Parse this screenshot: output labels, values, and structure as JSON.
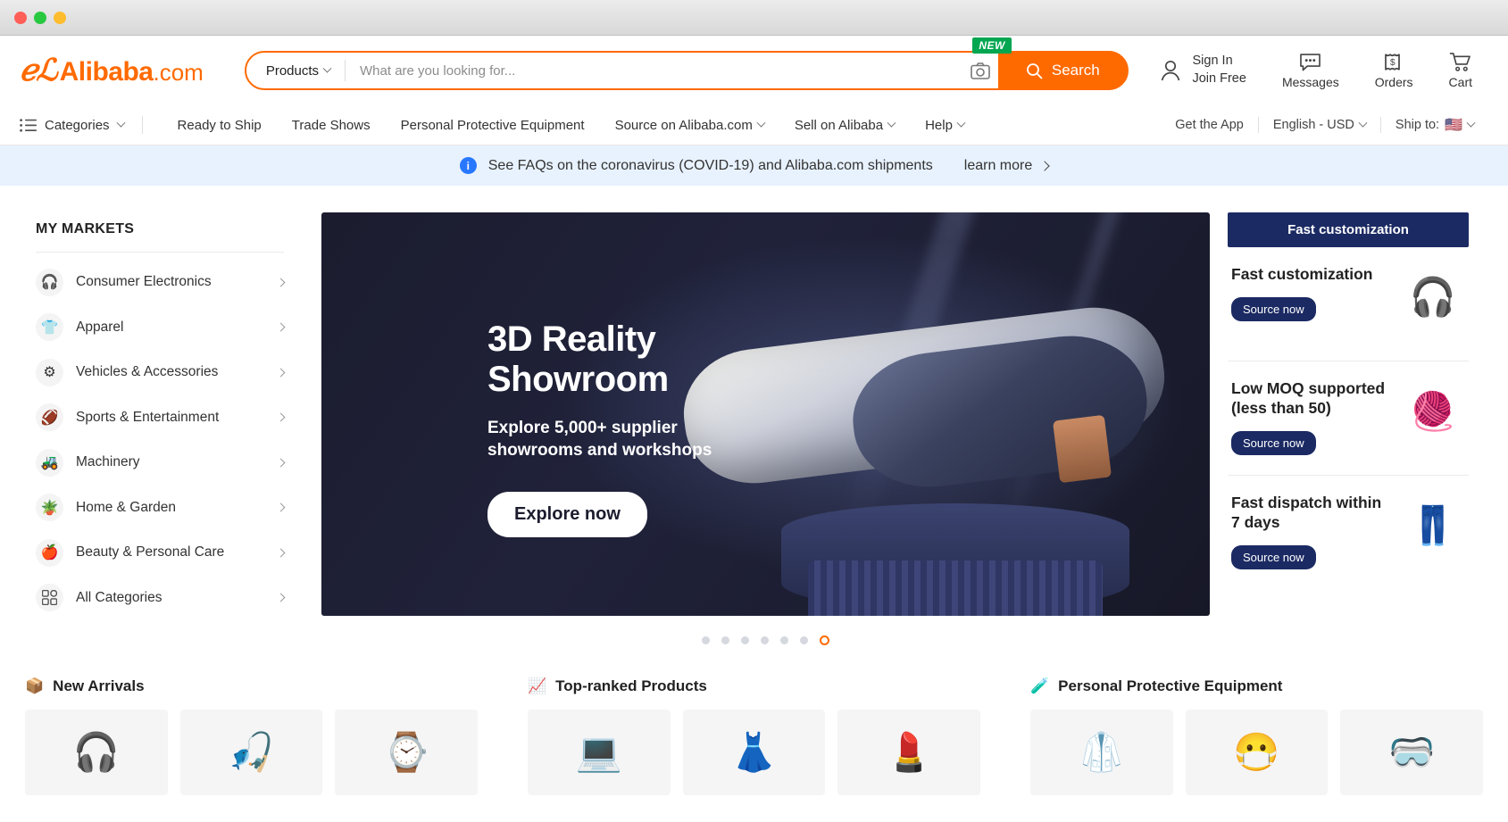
{
  "window": {
    "controls": [
      "close",
      "minimize",
      "maximize"
    ]
  },
  "header": {
    "logo": {
      "mark": "ℛ",
      "name": "Alibaba",
      "tld": ".com"
    },
    "search": {
      "category_label": "Products",
      "placeholder": "What are you looking for...",
      "value": "",
      "button_label": "Search",
      "camera_icon": "camera-icon",
      "new_badge": "NEW"
    },
    "account": {
      "line1": "Sign In",
      "line2": "Join Free",
      "icon": "user-icon"
    },
    "items": [
      {
        "label": "Messages",
        "icon": "message-icon"
      },
      {
        "label": "Orders",
        "icon": "orders-icon"
      },
      {
        "label": "Cart",
        "icon": "cart-icon"
      }
    ]
  },
  "nav": {
    "categories_label": "Categories",
    "links": [
      {
        "label": "Ready to Ship",
        "caret": false
      },
      {
        "label": "Trade Shows",
        "caret": false
      },
      {
        "label": "Personal Protective Equipment",
        "caret": false
      },
      {
        "label": "Source on Alibaba.com",
        "caret": true
      },
      {
        "label": "Sell on Alibaba",
        "caret": true
      },
      {
        "label": "Help",
        "caret": true
      }
    ],
    "right": {
      "get_app": "Get the App",
      "language": "English - USD",
      "ship_to_label": "Ship to:",
      "ship_to_flag": "🇺🇸"
    }
  },
  "covid_banner": {
    "icon": "info-pin-icon",
    "text": "See FAQs on the coronavirus (COVID-19) and Alibaba.com shipments",
    "link": "learn more"
  },
  "markets": {
    "title": "MY MARKETS",
    "items": [
      {
        "label": "Consumer Electronics",
        "icon": "🎧"
      },
      {
        "label": "Apparel",
        "icon": "👕"
      },
      {
        "label": "Vehicles & Accessories",
        "icon": "⚙"
      },
      {
        "label": "Sports & Entertainment",
        "icon": "🏈"
      },
      {
        "label": "Machinery",
        "icon": "🚜"
      },
      {
        "label": "Home & Garden",
        "icon": "🪴"
      },
      {
        "label": "Beauty & Personal Care",
        "icon": "🍎"
      },
      {
        "label": "All Categories",
        "icon": "⌗"
      }
    ]
  },
  "hero": {
    "title_line1": "3D Reality",
    "title_line2": "Showroom",
    "subtitle_line1": "Explore 5,000+ supplier",
    "subtitle_line2": "showrooms and workshops",
    "button_label": "Explore now",
    "carousel": {
      "total": 7,
      "active_index": 6
    }
  },
  "promo": {
    "header": "Fast customization",
    "items": [
      {
        "title": "Fast customization",
        "button": "Source now",
        "image": "🎧"
      },
      {
        "title": "Low MOQ supported (less than 50)",
        "button": "Source now",
        "image": "🧶"
      },
      {
        "title": "Fast dispatch within 7 days",
        "button": "Source now",
        "image": "👖"
      }
    ]
  },
  "cards": [
    {
      "title": "New Arrivals",
      "icon": "📦",
      "thumbs": [
        "🎧",
        "🎣",
        "⌚"
      ]
    },
    {
      "title": "Top-ranked Products",
      "icon": "📈",
      "thumbs": [
        "💻",
        "👗",
        "💄"
      ]
    },
    {
      "title": "Personal Protective Equipment",
      "icon": "🧪",
      "thumbs": [
        "🥼",
        "😷",
        "🥽"
      ]
    }
  ],
  "colors": {
    "brand_orange": "#ff6a00",
    "promo_navy": "#1b2a63",
    "banner_blue": "#e8f2fe",
    "page_bg": "#f0f1f5"
  }
}
